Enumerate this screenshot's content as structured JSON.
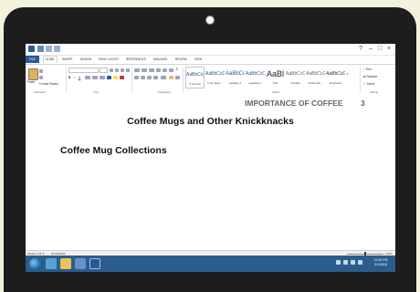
{
  "word": {
    "tabs": [
      "FILE",
      "HOME",
      "INSERT",
      "DESIGN",
      "PAGE LAYOUT",
      "REFERENCES",
      "MAILINGS",
      "REVIEW",
      "VIEW"
    ],
    "active_tab": "HOME",
    "clipboard": {
      "paste_label": "Paste",
      "format_painter_label": "Format Painter",
      "group_label": "Clipboard"
    },
    "font_group_label": "Font",
    "paragraph_group_label": "Paragraph",
    "styles_group_label": "Styles",
    "editing_group_label": "Editing",
    "styles": [
      {
        "sample": "AaBbCcDc",
        "name": "¶ Normal"
      },
      {
        "sample": "AaBbCcDc",
        "name": "¶ No Spac..."
      },
      {
        "sample": "AaBbCc",
        "name": "Heading 1"
      },
      {
        "sample": "AaBbCcC",
        "name": "Heading 2"
      },
      {
        "sample": "AaBl",
        "name": "Title"
      },
      {
        "sample": "AaBbCcC",
        "name": "Subtitle"
      },
      {
        "sample": "AaBbCcDc",
        "name": "Subtle Em..."
      },
      {
        "sample": "AaBbCcDc",
        "name": "Emphasis"
      }
    ],
    "editing": {
      "find": "Find",
      "replace": "Replace",
      "select": "Select"
    },
    "document": {
      "header": "IMPORTANCE OF COFFEE",
      "page_number": "3",
      "title": "Coffee Mugs and Other Knickknacks",
      "heading": "Coffee Mug Collections"
    },
    "status": {
      "page": "PAGE 3 OF 3",
      "words": "26 WORDS",
      "zoom": "140%"
    }
  },
  "taskbar": {
    "time": "12:36 PM",
    "date": "9/1/2016"
  },
  "colors": {
    "word_blue": "#2b579a",
    "taskbar": "#2a5d8c",
    "background": "#f3f3dd",
    "bezel": "#1d1d1d"
  }
}
